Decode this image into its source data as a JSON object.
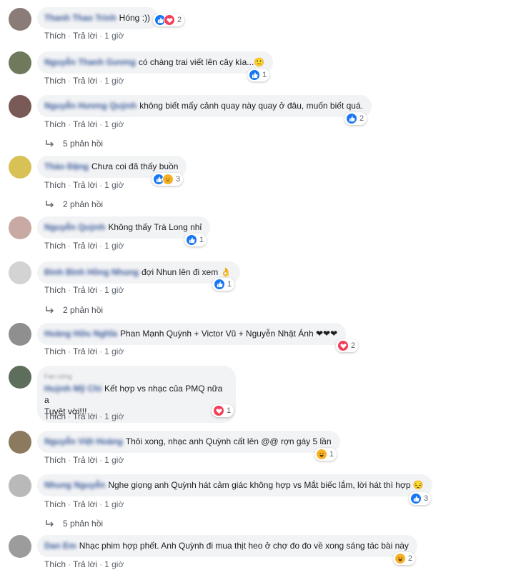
{
  "action_labels": {
    "like": "Thích",
    "reply": "Trả lời",
    "separator": "·"
  },
  "comments": [
    {
      "author": "Thanh Thao Trinh",
      "text": "Hóng :))",
      "reactions": [
        "like",
        "love"
      ],
      "count": "2",
      "time": "1 giờ",
      "replies": ""
    },
    {
      "author": "Nguyễn Thanh Gương",
      "text": "có chàng trai viết lên cây kìa...🙂",
      "reactions": [
        "like"
      ],
      "count": "1",
      "time": "1 giờ",
      "replies": ""
    },
    {
      "author": "Nguyễn Hương Quỳnh",
      "text": "không biết mấy cảnh quay này quay ở đâu, muốn biết quá.",
      "reactions": [
        "like"
      ],
      "count": "2",
      "time": "1 giờ",
      "replies": "5 phản hồi"
    },
    {
      "author": "Thảo Đặng",
      "text": "Chưa coi đã thấy buồn",
      "reactions": [
        "like",
        "sad"
      ],
      "count": "3",
      "time": "1 giờ",
      "replies": "2 phản hồi"
    },
    {
      "author": "Nguyễn Quỳnh",
      "text": "Không thấy Trà Long nhỉ",
      "reactions": [
        "like"
      ],
      "count": "1",
      "time": "1 giờ",
      "replies": ""
    },
    {
      "author": "Đinh Bình Hồng Nhung",
      "text": "đợi Nhun lên đi xem 👌",
      "reactions": [
        "like"
      ],
      "count": "1",
      "time": "1 giờ",
      "replies": "2 phản hồi"
    },
    {
      "author": "Hoàng Hữu Nghĩa",
      "text": "Phan Mạnh Quỳnh + Victor Vũ + Nguyễn Nhật Ánh ❤❤❤",
      "reactions": [
        "love"
      ],
      "count": "2",
      "time": "1 giờ",
      "replies": ""
    },
    {
      "author": "Huỳnh Mỹ Chi",
      "topfan": "Fan cứng",
      "text": "Kết hợp vs nhạc của PMQ nữa a",
      "text2": "Tuyệt vời!!!",
      "reactions": [
        "love"
      ],
      "count": "1",
      "time": "1 giờ",
      "replies": ""
    },
    {
      "author": "Nguyễn Việt Hoàng",
      "text": "Thôi xong, nhạc anh Quỳnh cất lên @@ rợn gáy 5 lần",
      "reactions": [
        "haha"
      ],
      "count": "1",
      "time": "1 giờ",
      "replies": ""
    },
    {
      "author": "Nhung Nguyễn",
      "text": "Nghe giọng anh Quỳnh hát cảm giác không hợp vs Mắt biếc lắm, lời hát thì hợp 😔",
      "reactions": [
        "like"
      ],
      "count": "3",
      "time": "1 giờ",
      "replies": "5 phản hồi"
    },
    {
      "author": "Dan Em",
      "text": "Nhạc phim hợp phết. Anh Quỳnh đi mua thịt heo ở chợ đo đo về xong sáng tác bài này",
      "reactions": [
        "haha"
      ],
      "count": "2",
      "time": "1 giờ",
      "replies": ""
    }
  ],
  "colors": {
    "link": "#385898",
    "bubble": "#f2f3f5",
    "like": "#1877f2",
    "love": "#f33e58",
    "haha": "#f7b125"
  }
}
